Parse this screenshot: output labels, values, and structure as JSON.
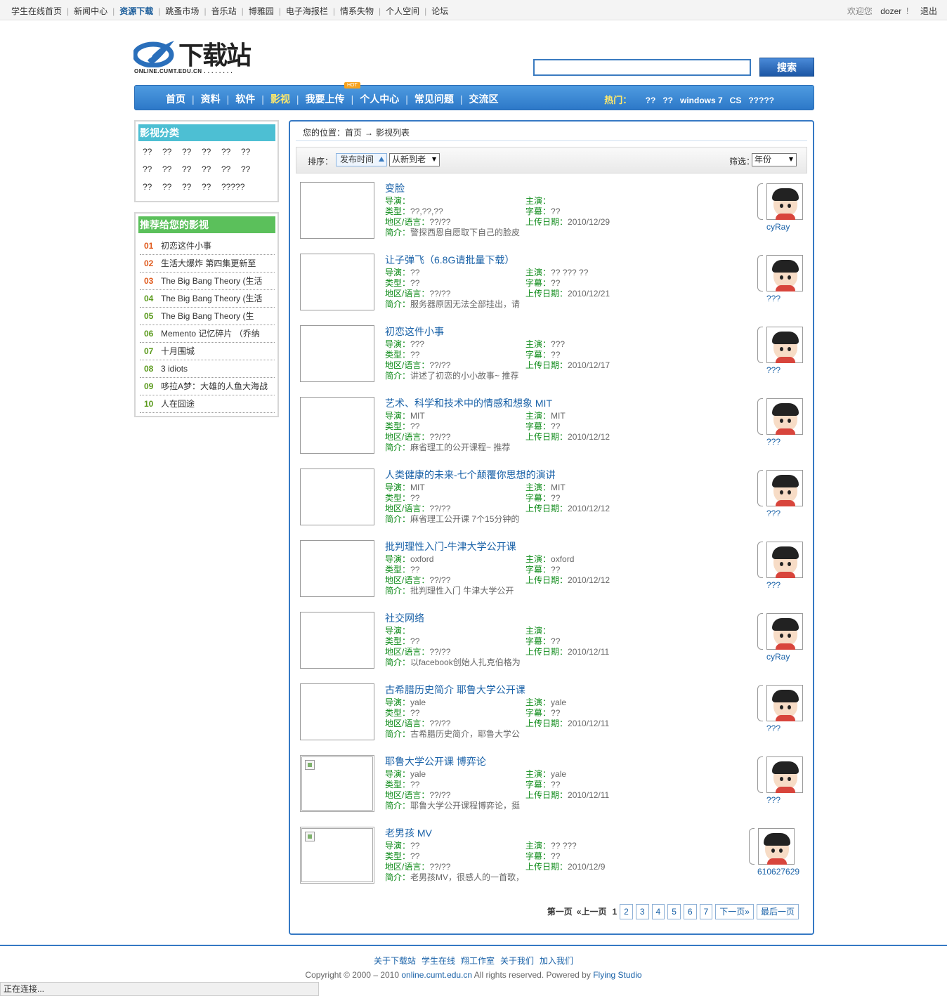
{
  "topbar": {
    "nav": [
      "学生在线首页",
      "新闻中心",
      "资源下载",
      "跳蚤市场",
      "音乐站",
      "博雅园",
      "电子海报栏",
      "情系失物",
      "个人空间",
      "论坛"
    ],
    "active_index": 2,
    "welcome": "欢迎您",
    "username": "dozer",
    "excl": "！",
    "logout": "退出"
  },
  "logo": {
    "title": "下载站",
    "subtitle": "ONLINE.CUMT.EDU.CN . . . . . . . ."
  },
  "search": {
    "placeholder": "",
    "button": "搜索"
  },
  "mainnav": {
    "items": [
      "首页",
      "资料",
      "软件",
      "影视",
      "我要上传",
      "个人中心",
      "常见问题",
      "交流区"
    ],
    "active_index": 3,
    "hot_badge": "HOT",
    "hot_label": "热门：",
    "hot_links": [
      "??",
      "??",
      "windows 7",
      "CS",
      "?????"
    ]
  },
  "categories": {
    "title": "影视分类",
    "rows": [
      [
        "??",
        "??",
        "??",
        "??",
        "??",
        "??"
      ],
      [
        "??",
        "??",
        "??",
        "??",
        "??",
        "??"
      ],
      [
        "??",
        "??",
        "??",
        "??",
        "?????"
      ]
    ]
  },
  "recommend": {
    "title": "推荐给您的影视",
    "items": [
      {
        "num": "01",
        "title": "初恋这件小事",
        "color": "#e05a1c"
      },
      {
        "num": "02",
        "title": "生活大爆炸 第四集更新至",
        "color": "#e05a1c"
      },
      {
        "num": "03",
        "title": "The Big Bang Theory (生活",
        "color": "#e05a1c"
      },
      {
        "num": "04",
        "title": "The Big Bang Theory (生活",
        "color": "#5a9a1c"
      },
      {
        "num": "05",
        "title": "The Big Bang Theory (生",
        "color": "#5a9a1c"
      },
      {
        "num": "06",
        "title": "Memento 记忆碎片 （乔纳",
        "color": "#5a9a1c"
      },
      {
        "num": "07",
        "title": "十月围城",
        "color": "#5a9a1c"
      },
      {
        "num": "08",
        "title": "3 idiots",
        "color": "#5a9a1c"
      },
      {
        "num": "09",
        "title": "哆拉A梦：大雄的人鱼大海战",
        "color": "#5a9a1c"
      },
      {
        "num": "10",
        "title": "人在囧途",
        "color": "#5a9a1c"
      }
    ]
  },
  "breadcrumb": {
    "prefix": "您的位置：首页",
    "arrow": "→",
    "current": "影视列表"
  },
  "sortbar": {
    "label": "排序：",
    "sort_field": "发布时间",
    "sort_order": "从新到老",
    "filter_label": "筛选：",
    "filter_value": "年份"
  },
  "labels": {
    "director": "导演：",
    "genre": "类型：",
    "region": "地区/语言：",
    "intro": "简介：",
    "actor": "主演：",
    "subtitle": "字幕：",
    "date": "上传日期："
  },
  "movies": [
    {
      "title": "变脸",
      "director": "",
      "genre": "??,??,??",
      "region": "??/??",
      "intro": "警探西恩自愿取下自己的脸皮",
      "actor": "",
      "subtitle": "??",
      "date": "2010/12/29",
      "uploader": "cyRay",
      "thumb_broken": false
    },
    {
      "title": "让子弹飞（6.8G请批量下载）",
      "director": "??",
      "genre": "??",
      "region": "??/??",
      "intro": "服务器原因无法全部挂出，请",
      "actor": "?? ??? ??",
      "subtitle": "??",
      "date": "2010/12/21",
      "uploader": "???",
      "thumb_broken": false
    },
    {
      "title": "初恋这件小事",
      "director": "???",
      "genre": "??",
      "region": "??/??",
      "intro": "讲述了初恋的小小故事~ 推荐",
      "actor": "???",
      "subtitle": "??",
      "date": "2010/12/17",
      "uploader": "???",
      "thumb_broken": false
    },
    {
      "title": "艺术、科学和技术中的情感和想象 MIT",
      "director": "MIT",
      "genre": "??",
      "region": "??/??",
      "intro": "麻省理工的公开课程~ 推荐",
      "actor": "MIT",
      "subtitle": "??",
      "date": "2010/12/12",
      "uploader": "???",
      "thumb_broken": false
    },
    {
      "title": "人类健康的未来-七个颠覆你思想的演讲",
      "director": "MIT",
      "genre": "??",
      "region": "??/??",
      "intro": "麻省理工公开课 7个15分钟的",
      "actor": "MIT",
      "subtitle": "??",
      "date": "2010/12/12",
      "uploader": "???",
      "thumb_broken": false
    },
    {
      "title": "批判理性入门-牛津大学公开课",
      "director": "oxford",
      "genre": "??",
      "region": "??/??",
      "intro": "批判理性入门 牛津大学公开",
      "actor": "oxford",
      "subtitle": "??",
      "date": "2010/12/12",
      "uploader": "???",
      "thumb_broken": false
    },
    {
      "title": "社交网络",
      "director": "",
      "genre": "??",
      "region": "??/??",
      "intro": "以facebook创始人扎克伯格为",
      "actor": "",
      "subtitle": "??",
      "date": "2010/12/11",
      "uploader": "cyRay",
      "thumb_broken": false
    },
    {
      "title": "古希腊历史简介 耶鲁大学公开课",
      "director": "yale",
      "genre": "??",
      "region": "??/??",
      "intro": "古希腊历史简介，耶鲁大学公",
      "actor": "yale",
      "subtitle": "??",
      "date": "2010/12/11",
      "uploader": "???",
      "thumb_broken": false
    },
    {
      "title": "耶鲁大学公开课 博弈论",
      "director": "yale",
      "genre": "??",
      "region": "??/??",
      "intro": "耶鲁大学公开课程博弈论，挺",
      "actor": "yale",
      "subtitle": "??",
      "date": "2010/12/11",
      "uploader": "???",
      "thumb_broken": true
    },
    {
      "title": "老男孩 MV",
      "director": "??",
      "genre": "??",
      "region": "??/??",
      "intro": "老男孩MV，很感人的一首歌，",
      "actor": "?? ???",
      "subtitle": "??",
      "date": "2010/12/9",
      "uploader": "610627629",
      "thumb_broken": true
    }
  ],
  "pager": {
    "first": "第一页",
    "prev": "«上一页",
    "current": "1",
    "pages": [
      "2",
      "3",
      "4",
      "5",
      "6",
      "7"
    ],
    "next": "下一页»",
    "last": "最后一页"
  },
  "footer": {
    "links": [
      "关于下载站",
      "学生在线",
      "翔工作室",
      "关于我们",
      "加入我们"
    ],
    "copy_prefix": "Copyright © 2000 – 2010",
    "domain": "online.cumt.edu.cn",
    "copy_mid": "All rights reserved. Powered by",
    "studio": "Flying Studio"
  },
  "status": "正在连接..."
}
